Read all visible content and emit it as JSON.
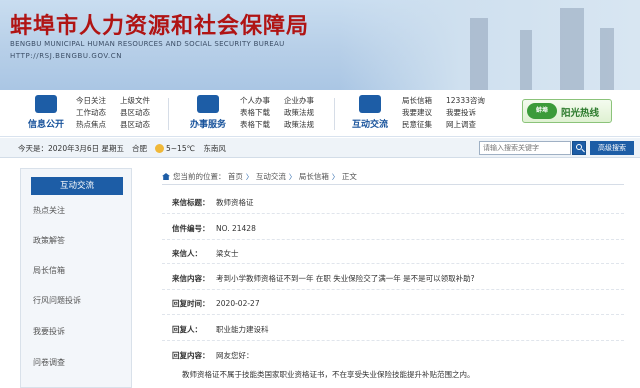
{
  "header": {
    "title": "蚌埠市人力资源和社会保障局",
    "subtitle": "BENGBU MUNICIPAL HUMAN RESOURCES AND SOCIAL SECURITY BUREAU",
    "url": "HTTP://RSJ.BENGBU.GOV.CN"
  },
  "nav": {
    "groups": [
      {
        "label": "信息公开",
        "links": [
          "今日关注",
          "上级文件",
          "工作动态",
          "县区动态",
          "热点焦点",
          "县区动态"
        ]
      },
      {
        "label": "办事服务",
        "links": [
          "个人办事",
          "企业办事",
          "表格下载",
          "政策法规",
          "表格下载",
          "政策法规"
        ]
      },
      {
        "label": "互动交流",
        "links": [
          "局长信箱",
          "12333咨询",
          "我要建议",
          "我要投诉",
          "民意征集",
          "网上调查"
        ]
      }
    ],
    "sunlight": {
      "badge": "蚌埠",
      "label": "阳光热线"
    }
  },
  "infobar": {
    "date": "今天是：2020年3月6日 星期五",
    "city": "合肥",
    "temp": "5~15℃",
    "wind": "东南风",
    "search_placeholder": "请输入搜索关键字",
    "advanced_search": "高级搜索"
  },
  "sidebar": {
    "title": "互动交流",
    "items": [
      "热点关注",
      "政策解答",
      "局长信箱",
      "行风问题投诉",
      "我要投诉",
      "问卷调查"
    ]
  },
  "breadcrumb": {
    "prefix": "您当前的位置：",
    "items": [
      "首页",
      "互动交流",
      "局长信箱",
      "正文"
    ]
  },
  "letter": {
    "fields": [
      {
        "key": "来信标题：",
        "value": "教师资格证"
      },
      {
        "key": "信件编号：",
        "value": "NO. 21428"
      },
      {
        "key": "来信人：",
        "value": "梁女士"
      },
      {
        "key": "来信内容：",
        "value": "考到小学教师资格证不到一年 在职 失业保险交了满一年 是不是可以领取补助?"
      },
      {
        "key": "回复时间：",
        "value": "2020-02-27"
      },
      {
        "key": "回复人：",
        "value": "职业能力建设科"
      },
      {
        "key": "回复内容：",
        "value": "网友您好："
      }
    ],
    "reply_body": "教师资格证不属于技能类国家职业资格证书，不在享受失业保险技能提升补贴范围之内。"
  }
}
